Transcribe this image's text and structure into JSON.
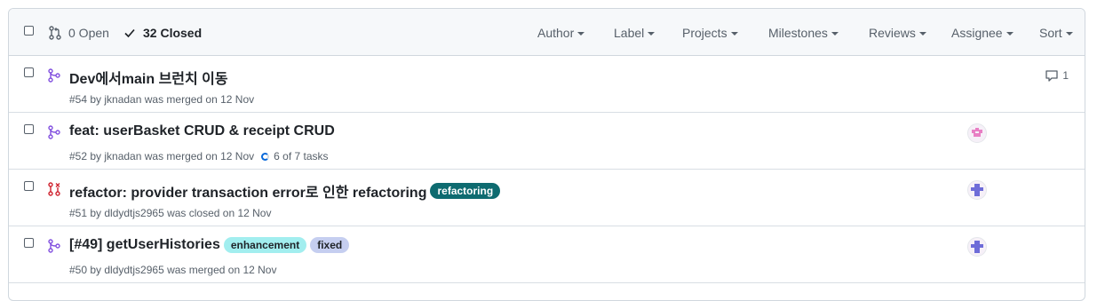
{
  "toolbar": {
    "open_label": "0 Open",
    "closed_label": "32 Closed",
    "filters": [
      "Author",
      "Label",
      "Projects",
      "Milestones",
      "Reviews",
      "Assignee",
      "Sort"
    ]
  },
  "rows": [
    {
      "title": "Dev에서main 브런치 이동",
      "meta": "#54 by jknadan was merged on 12 Nov",
      "comments": "1",
      "state_icon": "git-merge-icon"
    },
    {
      "title": "feat: userBasket CRUD & receipt CRUD",
      "meta": "#52 by jknadan was merged on 12 Nov",
      "tasks": "6 of 7 tasks",
      "state_icon": "git-merge-icon"
    },
    {
      "title": "refactor: provider transaction error로 인한 refactoring",
      "meta": "#51 by dldydtjs2965 was closed on 12 Nov",
      "labels": [
        {
          "name": "refactoring",
          "bg": "#0e6b70",
          "fg": "#ffffff"
        }
      ],
      "state_icon": "git-pull-request-closed-icon"
    },
    {
      "title": "[#49] getUserHistories",
      "meta": "#50 by dldydtjs2965 was merged on 12 Nov",
      "labels": [
        {
          "name": "enhancement",
          "bg": "#a2eeef",
          "fg": "#1f2328"
        },
        {
          "name": "fixed",
          "bg": "#c5cef0",
          "fg": "#1f2328"
        }
      ],
      "state_icon": "git-merge-icon"
    }
  ],
  "colors": {
    "merged": "#8250df",
    "closed": "#cf222e",
    "accent": "#0969da"
  }
}
